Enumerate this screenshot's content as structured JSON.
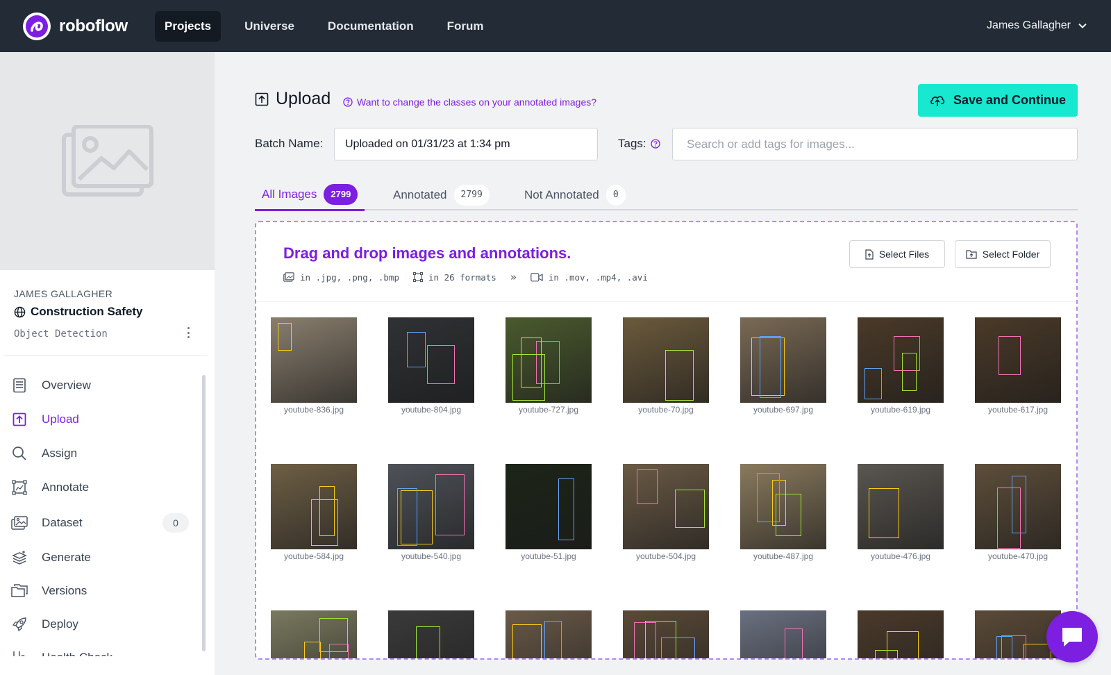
{
  "nav": {
    "brand": "roboflow",
    "items": [
      {
        "label": "Projects",
        "active": true
      },
      {
        "label": "Universe",
        "active": false
      },
      {
        "label": "Documentation",
        "active": false
      },
      {
        "label": "Forum",
        "active": false
      }
    ],
    "user": "James Gallagher"
  },
  "project": {
    "owner": "JAMES GALLAGHER",
    "name": "Construction Safety",
    "type": "Object Detection"
  },
  "sidebar": {
    "items": [
      {
        "label": "Overview",
        "icon": "overview-icon",
        "active": false
      },
      {
        "label": "Upload",
        "icon": "upload-icon",
        "active": true
      },
      {
        "label": "Assign",
        "icon": "search-icon",
        "active": false
      },
      {
        "label": "Annotate",
        "icon": "annotate-icon",
        "active": false
      },
      {
        "label": "Dataset",
        "icon": "dataset-icon",
        "active": false,
        "badge": "0"
      },
      {
        "label": "Generate",
        "icon": "generate-icon",
        "active": false
      },
      {
        "label": "Versions",
        "icon": "versions-icon",
        "active": false
      },
      {
        "label": "Deploy",
        "icon": "rocket-icon",
        "active": false
      },
      {
        "label": "Health Check",
        "icon": "stethoscope-icon",
        "active": false
      }
    ]
  },
  "upload": {
    "title": "Upload",
    "class_link": "Want to change the classes on your annotated images?",
    "save_label": "Save and Continue",
    "batch_label": "Batch Name:",
    "batch_value": "Uploaded on 01/31/23 at 1:34 pm",
    "tags_label": "Tags:",
    "tags_placeholder": "Search or add tags for images..."
  },
  "tabs": [
    {
      "label": "All Images",
      "count": "2799",
      "active": true
    },
    {
      "label": "Annotated",
      "count": "2799",
      "active": false
    },
    {
      "label": "Not Annotated",
      "count": "0",
      "active": false
    }
  ],
  "dropzone": {
    "title": "Drag and drop images and annotations.",
    "formats": {
      "images": "in .jpg, .png, .bmp",
      "annotations": "in 26 formats",
      "arrow": "»",
      "videos": "in .mov, .mp4, .avi"
    },
    "select_files": "Select Files",
    "select_folder": "Select Folder"
  },
  "images": [
    {
      "name": "youtube-836.jpg",
      "bg": "#8a7f6e"
    },
    {
      "name": "youtube-804.jpg",
      "bg": "#2f3134"
    },
    {
      "name": "youtube-727.jpg",
      "bg": "#4a5a2e"
    },
    {
      "name": "youtube-70.jpg",
      "bg": "#6b5a3c"
    },
    {
      "name": "youtube-697.jpg",
      "bg": "#7a6a55"
    },
    {
      "name": "youtube-619.jpg",
      "bg": "#4a3a28"
    },
    {
      "name": "youtube-617.jpg",
      "bg": "#4a3a28"
    },
    {
      "name": "youtube-584.jpg",
      "bg": "#6e5f45"
    },
    {
      "name": "youtube-540.jpg",
      "bg": "#4e5258"
    },
    {
      "name": "youtube-51.jpg",
      "bg": "#1c2418"
    },
    {
      "name": "youtube-504.jpg",
      "bg": "#6a5a45"
    },
    {
      "name": "youtube-487.jpg",
      "bg": "#8a7a5e"
    },
    {
      "name": "youtube-476.jpg",
      "bg": "#5a5650"
    },
    {
      "name": "youtube-470.jpg",
      "bg": "#5e4e3a"
    },
    {
      "name": "",
      "bg": "#7a7a60"
    },
    {
      "name": "",
      "bg": "#3a3a3a"
    },
    {
      "name": "",
      "bg": "#6a5a48"
    },
    {
      "name": "",
      "bg": "#5a4a38"
    },
    {
      "name": "",
      "bg": "#6a7080"
    },
    {
      "name": "",
      "bg": "#4a3a2a"
    },
    {
      "name": "",
      "bg": "#5a4a38"
    }
  ],
  "colors": {
    "accent": "#7c1fe0",
    "cta": "#17e8cf",
    "nav_bg": "#222b36"
  }
}
